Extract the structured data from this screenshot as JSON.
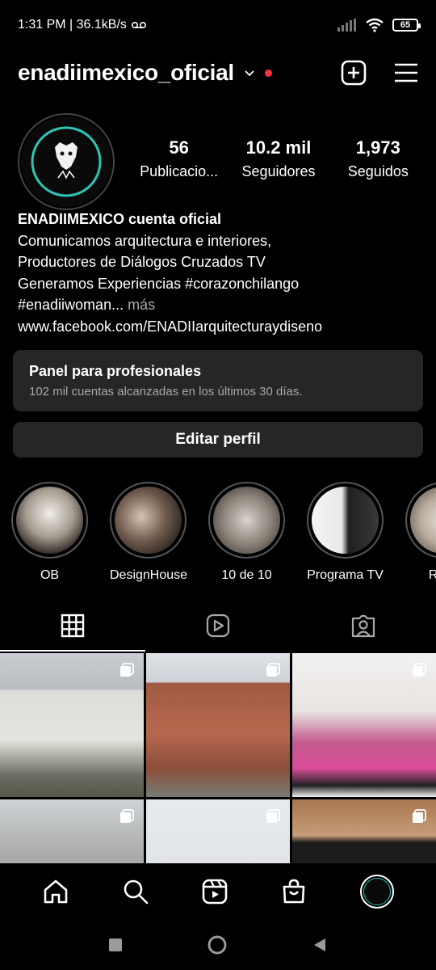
{
  "status_bar": {
    "time_info": "1:31 PM | 36.1kB/s",
    "battery": "65"
  },
  "header": {
    "username": "enadiimexico_oficial"
  },
  "profile": {
    "avatar_icon": "enadii-logo",
    "stats": [
      {
        "number": "56",
        "label": "Publicacio..."
      },
      {
        "number": "10.2 mil",
        "label": "Seguidores"
      },
      {
        "number": "1,973",
        "label": "Seguidos"
      }
    ],
    "bio": {
      "name": "ENADIIMEXICO cuenta oficial",
      "lines": [
        "Comunicamos arquitectura e interiores,",
        "Productores de Diálogos Cruzados TV",
        "Generamos Experiencias #corazonchilango"
      ],
      "truncated_line": "#enadiiwoman...",
      "more": "más",
      "link": "www.facebook.com/ENADIIarquitecturaydiseno"
    }
  },
  "panel": {
    "title": "Panel para profesionales",
    "subtitle": "102 mil cuentas alcanzadas en los últimos 30 días."
  },
  "edit_button": "Editar perfil",
  "highlights": [
    {
      "label": "OB"
    },
    {
      "label": "DesignHouse"
    },
    {
      "label": "10 de 10"
    },
    {
      "label": "Programa TV"
    },
    {
      "label": "Recu"
    }
  ],
  "tabs": [
    {
      "icon": "grid-icon",
      "active": true
    },
    {
      "icon": "reels-icon",
      "active": false
    },
    {
      "icon": "tagged-icon",
      "active": false
    }
  ],
  "grid_posts": [
    {
      "type": "carousel"
    },
    {
      "type": "carousel"
    },
    {
      "type": "carousel"
    },
    {
      "type": "carousel"
    },
    {
      "type": "carousel"
    },
    {
      "type": "carousel"
    }
  ],
  "bottom_nav": [
    "home-icon",
    "search-icon",
    "reels-icon",
    "shop-icon",
    "profile-avatar"
  ],
  "colors": {
    "background": "#000000",
    "surface": "#262626",
    "secondary_text": "#a8a8a8",
    "notification_dot": "#ff3040",
    "logo_accent": "#2ec4b6"
  }
}
